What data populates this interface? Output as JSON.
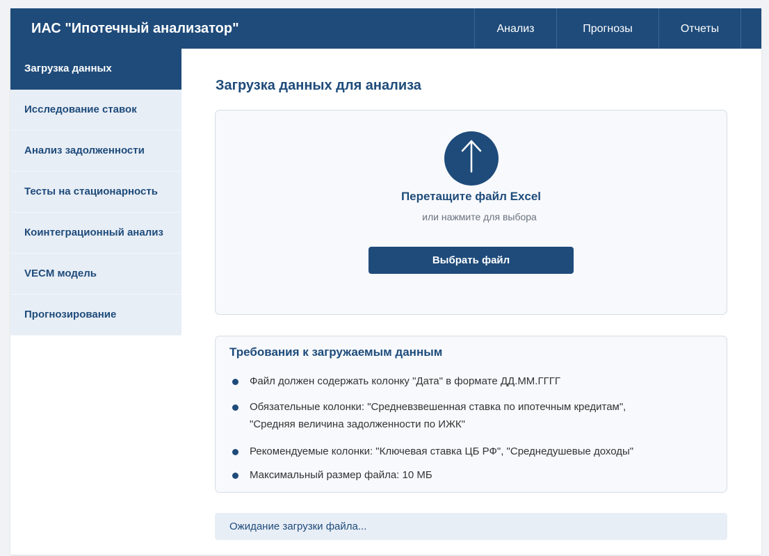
{
  "header": {
    "title": "ИАС \"Ипотечный анализатор\"",
    "nav": [
      "Анализ",
      "Прогнозы",
      "Отчеты"
    ]
  },
  "sidebar": {
    "items": [
      {
        "label": "Загрузка данных",
        "active": true
      },
      {
        "label": "Исследование ставок",
        "active": false
      },
      {
        "label": "Анализ задолженности",
        "active": false
      },
      {
        "label": "Тесты на стационарность",
        "active": false
      },
      {
        "label": "Коинтеграционный анализ",
        "active": false
      },
      {
        "label": "VECM модель",
        "active": false
      },
      {
        "label": "Прогнозирование",
        "active": false
      }
    ]
  },
  "main": {
    "title": "Загрузка данных для анализа",
    "upload": {
      "icon": "upload-arrow-icon",
      "title": "Перетащите файл Excel",
      "subtitle": "или нажмите для выбора",
      "button_label": "Выбрать файл"
    },
    "requirements": {
      "title": "Требования к загружаемым данным",
      "items": [
        [
          "Файл должен содержать колонку \"Дата\" в формате ДД.ММ.ГГГГ"
        ],
        [
          "Обязательные колонки: \"Средневзвешенная ставка по ипотечным кредитам\",",
          "\"Средняя величина задолженности по ИЖК\""
        ],
        [
          "Рекомендуемые колонки: \"Ключевая ставка ЦБ РФ\", \"Среднедушевые доходы\""
        ],
        [
          "Максимальный размер файла: 10 МБ"
        ]
      ]
    },
    "status": "Ожидание загрузки файла..."
  },
  "colors": {
    "primary": "#1e4b7a",
    "sidebar_bg": "#e8eef6",
    "panel_bg": "#f7f9fc",
    "border": "#d7dde6",
    "text": "#333333",
    "muted": "#6b7280"
  }
}
